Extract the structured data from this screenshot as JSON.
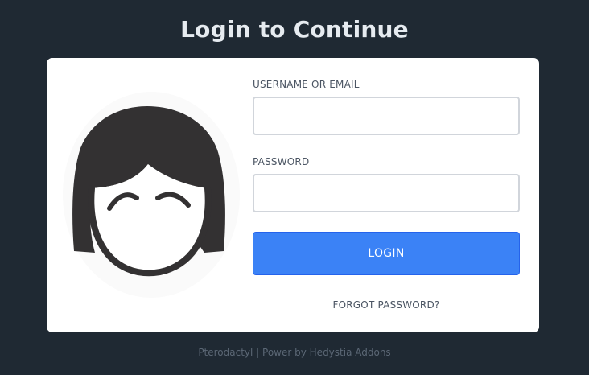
{
  "page": {
    "title": "Login to Continue"
  },
  "avatar": {
    "icon": "avatar-icon"
  },
  "form": {
    "username_label": "USERNAME OR EMAIL",
    "username_value": "",
    "password_label": "PASSWORD",
    "password_value": "",
    "login_label": "LOGIN",
    "forgot_label": "FORGOT PASSWORD?"
  },
  "footer": {
    "text": "Pterodactyl | Power by Hedystia Addons"
  },
  "colors": {
    "background": "#1f2933",
    "card": "#ffffff",
    "accent": "#3b82f6",
    "avatar_hair": "#333132"
  }
}
